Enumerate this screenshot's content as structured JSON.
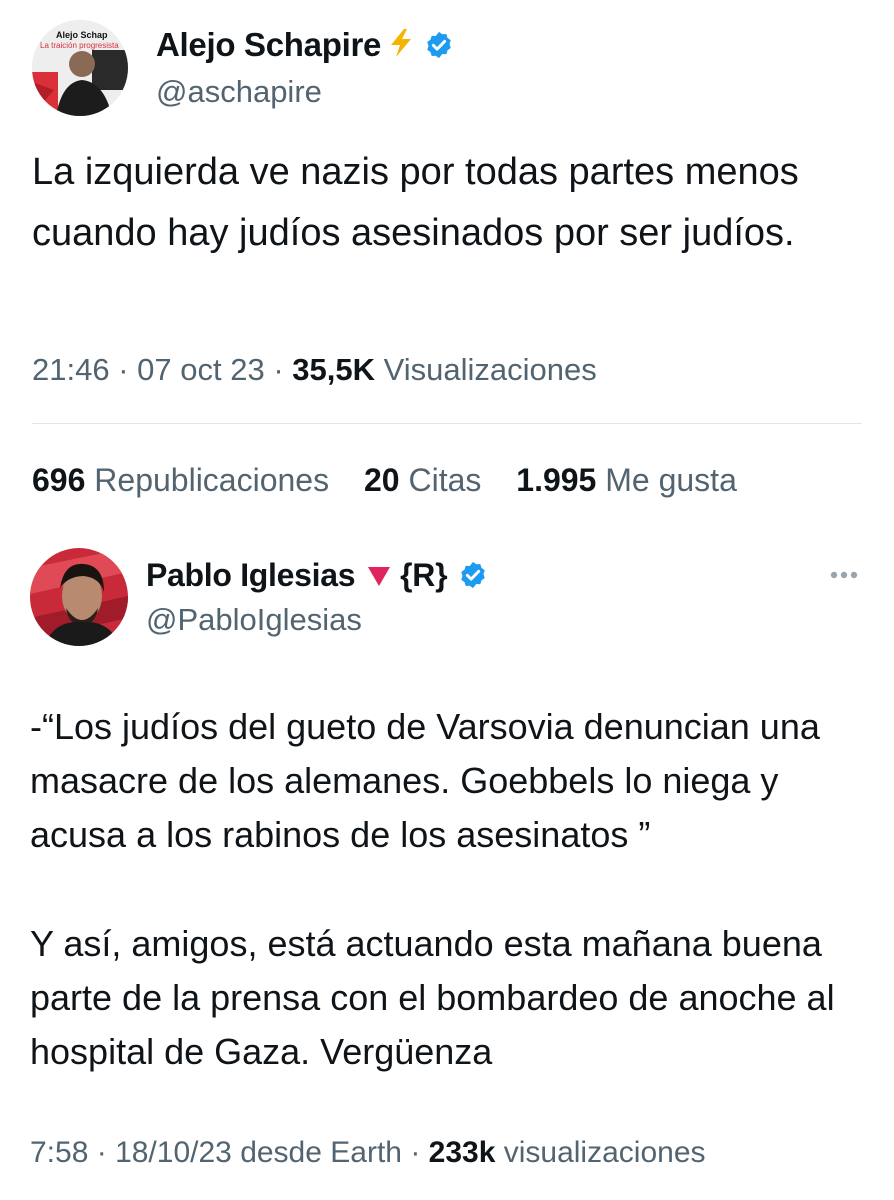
{
  "tweet1": {
    "name": "Alejo Schapire",
    "handle": "@aschapire",
    "avatar_caption_1": "Alejo Schap",
    "avatar_caption_2": "La traición progresista",
    "text": "La izquierda ve nazis por todas partes menos cuando hay judíos asesinados por ser judíos.",
    "time": "21:46",
    "date": "07 oct 23",
    "views_count": "35,5K",
    "views_label": "Visualizaciones",
    "stats": {
      "reposts_count": "696",
      "reposts_label": "Republicaciones",
      "quotes_count": "20",
      "quotes_label": "Citas",
      "likes_count": "1.995",
      "likes_label": "Me gusta"
    }
  },
  "tweet2": {
    "name": "Pablo Iglesias",
    "name_suffix": "{R}",
    "handle": "@PabloIglesias",
    "text_p1": "-“Los judíos del gueto de Varsovia  denuncian una masacre de los alemanes. Goebbels lo niega y acusa a los rabinos de los asesinatos ”",
    "text_p2": "Y así, amigos, está actuando esta mañana buena parte de la prensa con el bombardeo de anoche al hospital de Gaza. Vergüenza",
    "time": "7:58",
    "date": "18/10/23",
    "source": "desde Earth",
    "views_count": "233k",
    "views_label": "visualizaciones"
  },
  "icons": {
    "lightning": "lightning-icon",
    "verified": "verified-badge-icon",
    "red_triangle": "red-triangle-icon",
    "more": "more-options-icon"
  },
  "colors": {
    "verified_blue": "#1d9bf0",
    "lightning_yellow": "#f4b400",
    "triangle_red": "#e0245e",
    "secondary_text": "#536471"
  }
}
